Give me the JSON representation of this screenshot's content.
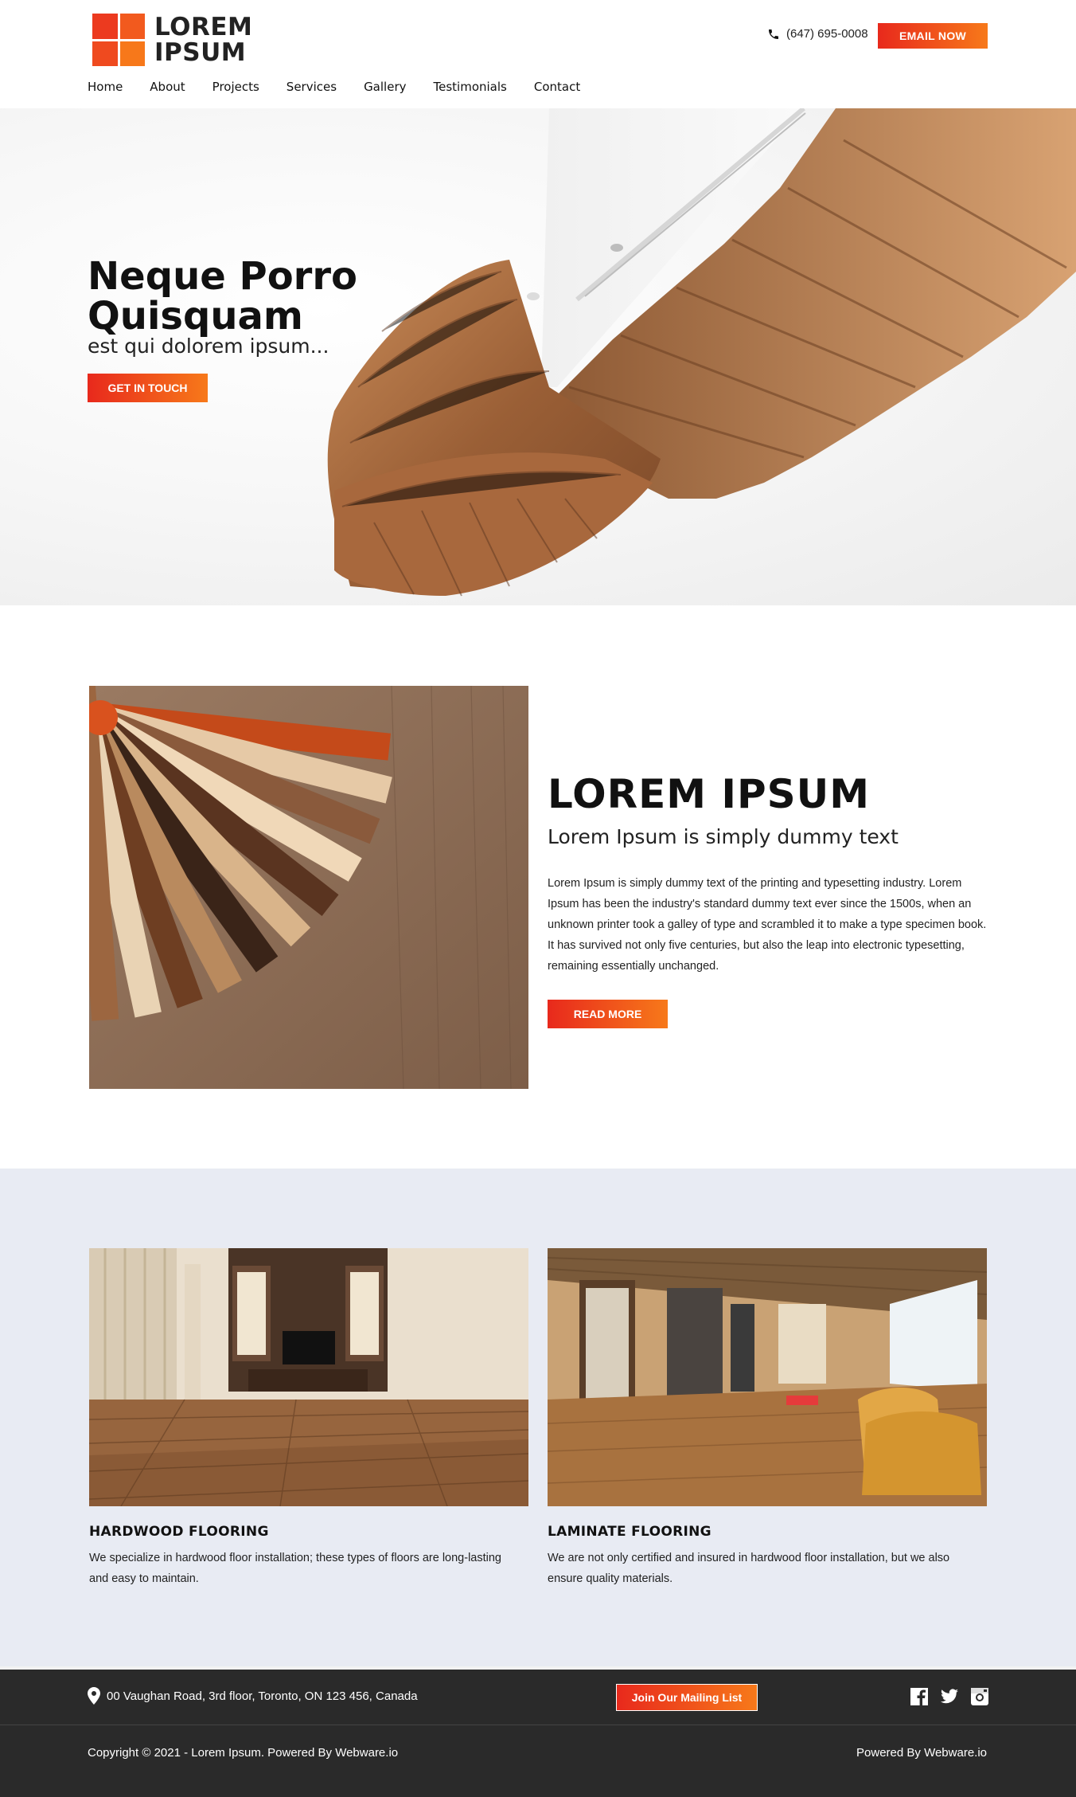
{
  "brand": {
    "line1": "LOREM",
    "line2": "IPSUM"
  },
  "header": {
    "phone": "(647) 695-0008",
    "email_button": "EMAIL NOW"
  },
  "nav": {
    "items": [
      "Home",
      "About",
      "Projects",
      "Services",
      "Gallery",
      "Testimonials",
      "Contact"
    ]
  },
  "hero": {
    "title_line1": "Neque Porro",
    "title_line2": "Quisquam",
    "subtitle": "est qui dolorem ipsum...",
    "button": "GET IN TOUCH"
  },
  "about": {
    "heading": "LOREM IPSUM",
    "subheading": "Lorem Ipsum is simply dummy text",
    "paragraph": "Lorem Ipsum is simply dummy text of the printing and typesetting industry. Lorem Ipsum has been the industry's standard dummy text ever since the 1500s, when an unknown printer took a galley of type and scrambled it to make a type specimen book. It has survived not only five centuries, but also the leap into electronic typesetting, remaining essentially unchanged.",
    "button": "READ MORE"
  },
  "services": [
    {
      "title": "HARDWOOD FLOORING",
      "text": "We specialize in hardwood floor installation; these types of floors are long-lasting and easy to maintain."
    },
    {
      "title": "LAMINATE FLOORING",
      "text": "We are not only certified and insured in hardwood floor installation, but we also ensure quality materials."
    }
  ],
  "footer": {
    "address": "00 Vaughan Road, 3rd floor, Toronto, ON 123 456, Canada",
    "mailing_button": "Join Our Mailing List",
    "copyright": "Copyright © 2021 - Lorem Ipsum. Powered By Webware.io",
    "powered": "Powered By Webware.io",
    "social": [
      "facebook-icon",
      "twitter-icon",
      "instagram-icon"
    ]
  },
  "colors": {
    "accent_start": "#e8291c",
    "accent_end": "#f7791a",
    "services_bg": "#e8ebf3",
    "footer_bg": "#2a2a2a"
  }
}
